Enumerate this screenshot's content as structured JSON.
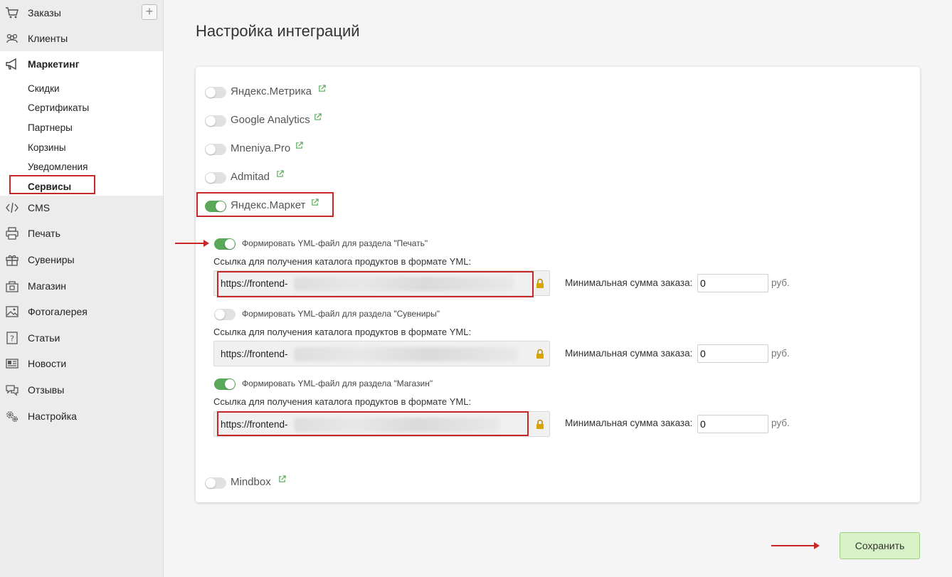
{
  "sidebar": {
    "add_label": "+",
    "items": [
      {
        "label": "Заказы",
        "icon": "cart-icon"
      },
      {
        "label": "Клиенты",
        "icon": "users-icon"
      },
      {
        "label": "Маркетинг",
        "icon": "megaphone-icon"
      },
      {
        "label": "CMS",
        "icon": "code-icon"
      },
      {
        "label": "Печать",
        "icon": "printer-icon"
      },
      {
        "label": "Сувениры",
        "icon": "gift-icon"
      },
      {
        "label": "Магазин",
        "icon": "shop-icon"
      },
      {
        "label": "Фотогалерея",
        "icon": "gallery-icon"
      },
      {
        "label": "Статьи",
        "icon": "question-icon"
      },
      {
        "label": "Новости",
        "icon": "newspaper-icon"
      },
      {
        "label": "Отзывы",
        "icon": "chat-icon"
      },
      {
        "label": "Настройка",
        "icon": "gears-icon"
      }
    ],
    "marketing_sub": [
      "Скидки",
      "Сертификаты",
      "Партнеры",
      "Корзины",
      "Уведомления",
      "Сервисы"
    ]
  },
  "page": {
    "title": "Настройка интеграций",
    "save_label": "Сохранить"
  },
  "services": [
    {
      "label": "Яндекс.Метрика",
      "enabled": false
    },
    {
      "label": "Google Analytics",
      "enabled": false
    },
    {
      "label": "Mneniya.Pro",
      "enabled": false
    },
    {
      "label": "Admitad",
      "enabled": false
    },
    {
      "label": "Яндекс.Маркет",
      "enabled": true
    },
    {
      "label": "Mindbox",
      "enabled": false
    }
  ],
  "yml_sections": [
    {
      "label": "Формировать YML-файл для раздела \"Печать\"",
      "enabled": true,
      "caption": "Ссылка для получения каталога продуктов в формате YML:",
      "url": "https://frontend-",
      "min_label": "Минимальная сумма заказа:",
      "min_value": "0",
      "currency": "руб."
    },
    {
      "label": "Формировать YML-файл для раздела \"Сувениры\"",
      "enabled": false,
      "caption": "Ссылка для получения каталога продуктов в формате YML:",
      "url": "https://frontend-",
      "min_label": "Минимальная сумма заказа:",
      "min_value": "0",
      "currency": "руб."
    },
    {
      "label": "Формировать YML-файл для раздела \"Магазин\"",
      "enabled": true,
      "caption": "Ссылка для получения каталога продуктов в формате YML:",
      "url": "https://frontend-",
      "min_label": "Минимальная сумма заказа:",
      "min_value": "0",
      "currency": "руб."
    }
  ],
  "colors": {
    "toggle_on": "#5aa85a",
    "highlight": "#c62828",
    "save_bg": "#d6f2c6"
  }
}
